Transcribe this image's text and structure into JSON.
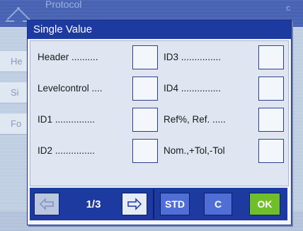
{
  "background": {
    "title": "Protocol",
    "title_right": "c",
    "rows": [
      "He",
      "Si",
      "Fo"
    ]
  },
  "dialog": {
    "title": "Single Value",
    "left_fields": [
      {
        "label": "Header ..........",
        "checked": false
      },
      {
        "label": "Levelcontrol ....",
        "checked": false
      },
      {
        "label": "ID1 ...............",
        "checked": false
      },
      {
        "label": "ID2 ...............",
        "checked": false
      }
    ],
    "right_fields": [
      {
        "label": "ID3 ...............",
        "checked": false
      },
      {
        "label": "ID4 ...............",
        "checked": false
      },
      {
        "label": "Ref%, Ref. .....",
        "checked": false
      },
      {
        "label": "Nom.,+Tol,-Tol",
        "checked": false
      }
    ]
  },
  "buttonbar": {
    "prev_icon": "arrow-left-icon",
    "page_indicator": "1/3",
    "next_icon": "arrow-right-icon",
    "std_label": "STD",
    "c_label": "C",
    "ok_label": "OK"
  },
  "colors": {
    "title_bar": "#1d3aa0",
    "ok_button": "#6fbf2a",
    "control_button": "#4f6fd6"
  }
}
